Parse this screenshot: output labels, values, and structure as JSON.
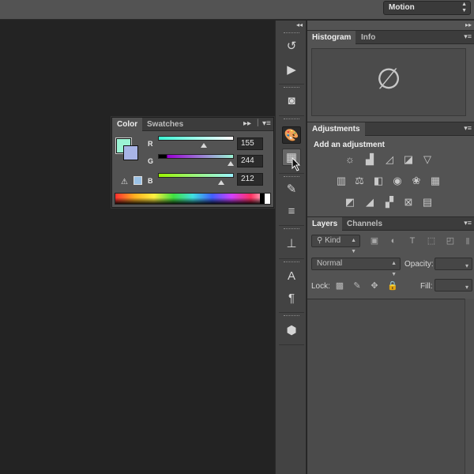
{
  "topbar": {
    "workspace": "Motion",
    "workspace_arrow": "⇕"
  },
  "color_panel": {
    "tabs": [
      "Color",
      "Swatches"
    ],
    "menu_icon": "panel-menu-icon",
    "colors": {
      "foreground": "#9bf4d4",
      "background": "#a8b4e6"
    },
    "channels": [
      {
        "label": "R",
        "value": "155",
        "fraction": 0.608
      },
      {
        "label": "G",
        "value": "244",
        "fraction": 0.957
      },
      {
        "label": "B",
        "value": "212",
        "fraction": 0.831
      }
    ]
  },
  "dock": {
    "icons": [
      "history-icon",
      "actions-play-icon",
      "properties-icon",
      "color-palette-icon",
      "grid-swatches-icon",
      "brush-presets-icon",
      "brush-settings-icon",
      "clone-source-icon",
      "character-icon",
      "paragraph-icon",
      "3d-cube-icon"
    ]
  },
  "histogram_panel": {
    "tabs": [
      "Histogram",
      "Info"
    ],
    "empty_symbol": "∅"
  },
  "adjustments_panel": {
    "tabs": [
      "Adjustments"
    ],
    "title": "Add an adjustment",
    "icons": [
      "brightness-icon",
      "levels-icon",
      "curves-icon",
      "exposure-icon",
      "vibrance-icon",
      "hue-saturation-icon",
      "color-balance-icon",
      "black-white-icon",
      "photo-filter-icon",
      "channel-mixer-icon",
      "color-lookup-icon",
      "invert-icon",
      "posterize-icon",
      "threshold-icon",
      "selective-color-icon",
      "gradient-map-icon"
    ]
  },
  "layers_panel": {
    "tabs": [
      "Layers",
      "Channels"
    ],
    "filter": "Kind",
    "blend_mode": "Normal",
    "opacity_label": "Opacity:",
    "lock_label": "Lock:",
    "fill_label": "Fill:"
  }
}
